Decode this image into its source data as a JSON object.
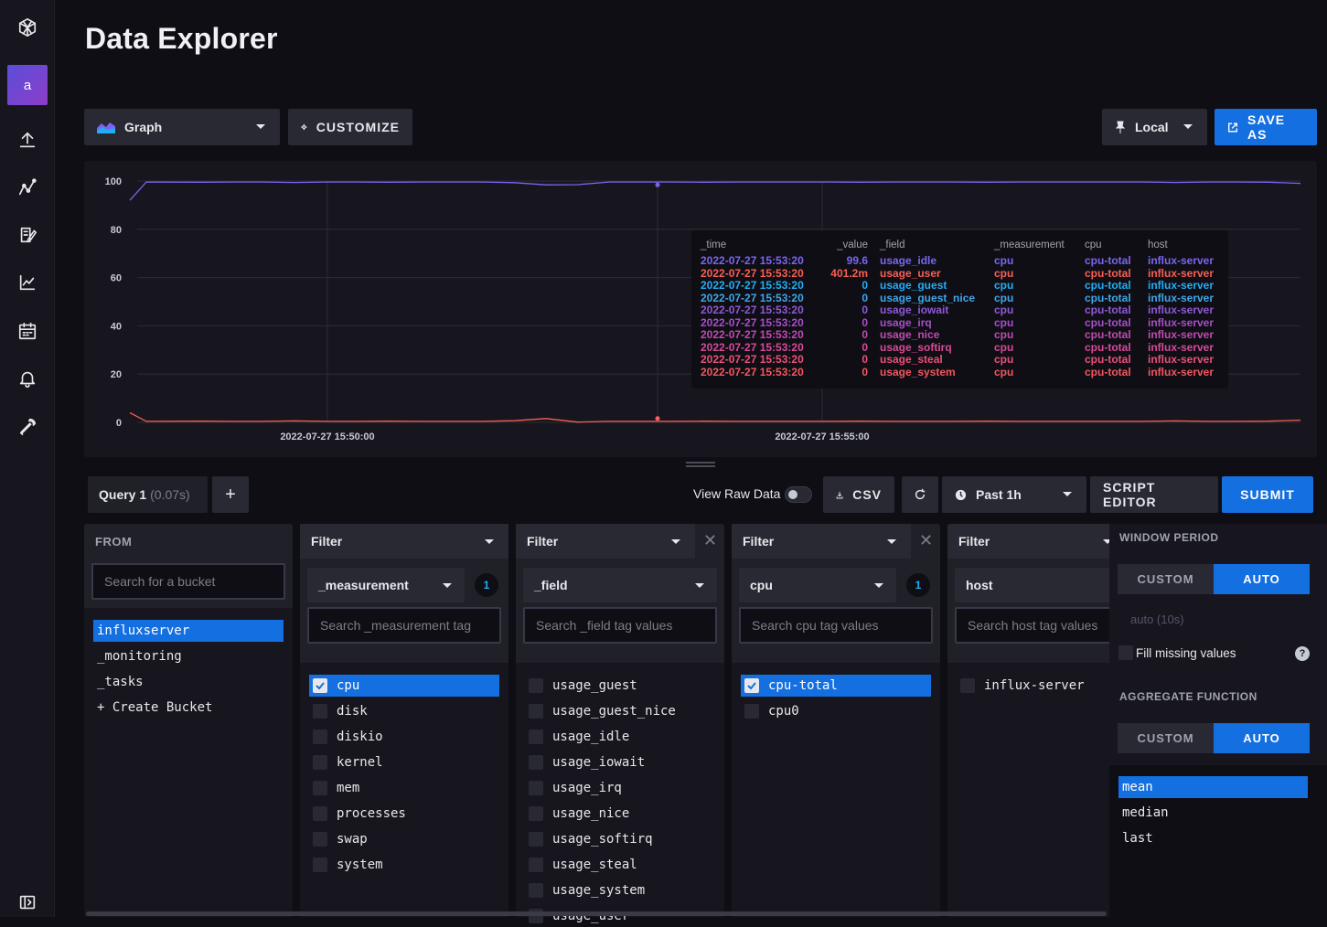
{
  "page": {
    "title": "Data Explorer"
  },
  "sidebar": {
    "avatar_letter": "a",
    "icons": [
      "influx-logo-icon",
      "upload-icon",
      "graph-icon",
      "notebook-icon",
      "chart-icon",
      "calendar-icon",
      "bell-icon",
      "wrench-icon",
      "collapse-icon"
    ]
  },
  "toolbar": {
    "graph_type": "Graph",
    "customize": "CUSTOMIZE",
    "timezone": "Local",
    "save_as": "SAVE AS"
  },
  "chart_data": {
    "type": "line",
    "ylim": [
      0,
      100
    ],
    "y_ticks": [
      "100",
      "80",
      "60",
      "40",
      "20",
      "0"
    ],
    "x_ticks": [
      "2022-07-27 15:50:00",
      "2022-07-27 15:55:00"
    ],
    "colors": {
      "accent": "#7a65f2",
      "secondary": "#f95f53"
    },
    "series": [
      {
        "name": "usage_idle",
        "color": "#7a65f2",
        "values": [
          92,
          99.6,
          99.5,
          99.6,
          99.6,
          99.4,
          99.6,
          99.6,
          99.5,
          99.6,
          99.6,
          99.6,
          99.3,
          98.4,
          98.5,
          99.6,
          99.6,
          99.6,
          99.5,
          99.6,
          99.6,
          99.6,
          99.6,
          99.5,
          99.6,
          99.6,
          99.6,
          99.5,
          99.6,
          99.6,
          99.6,
          99.6,
          99.6,
          99.4,
          99.6,
          99.6,
          99.5,
          99
        ]
      },
      {
        "name": "usage_user",
        "color": "#f95f53",
        "values": [
          4,
          0.4,
          0.5,
          0.4,
          0.4,
          0.6,
          0.4,
          0.4,
          0.5,
          0.4,
          0.4,
          0.4,
          0.7,
          1.6,
          0.1,
          0.4,
          0.4,
          0.4,
          0.5,
          0.4,
          0.4,
          0.4,
          0.4,
          0.5,
          0.4,
          0.4,
          0.4,
          0.5,
          0.4,
          0.4,
          0.4,
          0.4,
          0.4,
          0.6,
          0.4,
          0.4,
          0.5,
          0.9
        ]
      }
    ],
    "highlight_index": 13
  },
  "legend": {
    "headers": [
      "_time",
      "_value",
      "_field",
      "_measurement",
      "cpu",
      "host"
    ],
    "rows": [
      {
        "time": "2022-07-27 15:53:20",
        "value": "99.6",
        "field": "usage_idle",
        "measurement": "cpu",
        "cpu": "cpu-total",
        "host": "influx-server",
        "color": "#7a65f2"
      },
      {
        "time": "2022-07-27 15:53:20",
        "value": "401.2m",
        "field": "usage_user",
        "measurement": "cpu",
        "cpu": "cpu-total",
        "host": "influx-server",
        "color": "#f95f53"
      },
      {
        "time": "2022-07-27 15:53:20",
        "value": "0",
        "field": "usage_guest",
        "measurement": "cpu",
        "cpu": "cpu-total",
        "host": "influx-server",
        "color": "#22adf6"
      },
      {
        "time": "2022-07-27 15:53:20",
        "value": "0",
        "field": "usage_guest_nice",
        "measurement": "cpu",
        "cpu": "cpu-total",
        "host": "influx-server",
        "color": "#3fa6e8"
      },
      {
        "time": "2022-07-27 15:53:20",
        "value": "0",
        "field": "usage_iowait",
        "measurement": "cpu",
        "cpu": "cpu-total",
        "host": "influx-server",
        "color": "#8e59d6"
      },
      {
        "time": "2022-07-27 15:53:20",
        "value": "0",
        "field": "usage_irq",
        "measurement": "cpu",
        "cpu": "cpu-total",
        "host": "influx-server",
        "color": "#a64fc9"
      },
      {
        "time": "2022-07-27 15:53:20",
        "value": "0",
        "field": "usage_nice",
        "measurement": "cpu",
        "cpu": "cpu-total",
        "host": "influx-server",
        "color": "#c04bb0"
      },
      {
        "time": "2022-07-27 15:53:20",
        "value": "0",
        "field": "usage_softirq",
        "measurement": "cpu",
        "cpu": "cpu-total",
        "host": "influx-server",
        "color": "#d74b95"
      },
      {
        "time": "2022-07-27 15:53:20",
        "value": "0",
        "field": "usage_steal",
        "measurement": "cpu",
        "cpu": "cpu-total",
        "host": "influx-server",
        "color": "#e9507a"
      },
      {
        "time": "2022-07-27 15:53:20",
        "value": "0",
        "field": "usage_system",
        "measurement": "cpu",
        "cpu": "cpu-total",
        "host": "influx-server",
        "color": "#f4565f"
      }
    ]
  },
  "query_bar": {
    "query_name": "Query 1",
    "query_time": "(0.07s)",
    "add": "+",
    "view_raw": "View Raw Data",
    "csv": "CSV",
    "time_range": "Past 1h",
    "script_editor": "SCRIPT EDITOR",
    "submit": "SUBMIT"
  },
  "from": {
    "title": "FROM",
    "search_placeholder": "Search for a bucket",
    "buckets": [
      "influxserver",
      "_monitoring",
      "_tasks",
      "+ Create Bucket"
    ]
  },
  "filter1": {
    "title": "Filter",
    "key": "_measurement",
    "count": "1",
    "search_placeholder": "Search _measurement tag",
    "values": [
      "cpu",
      "disk",
      "diskio",
      "kernel",
      "mem",
      "processes",
      "swap",
      "system"
    ]
  },
  "filter2": {
    "title": "Filter",
    "key": "_field",
    "search_placeholder": "Search _field tag values",
    "values": [
      "usage_guest",
      "usage_guest_nice",
      "usage_idle",
      "usage_iowait",
      "usage_irq",
      "usage_nice",
      "usage_softirq",
      "usage_steal",
      "usage_system",
      "usage_user"
    ]
  },
  "filter3": {
    "title": "Filter",
    "key": "cpu",
    "count": "1",
    "search_placeholder": "Search cpu tag values",
    "values": [
      "cpu-total",
      "cpu0"
    ]
  },
  "filter4": {
    "title": "Filter",
    "key": "host",
    "search_placeholder": "Search host tag values",
    "values": [
      "influx-server"
    ]
  },
  "aggregate": {
    "window_title": "WINDOW PERIOD",
    "custom": "CUSTOM",
    "auto": "AUTO",
    "window_value": "auto (10s)",
    "fill_missing": "Fill missing values",
    "help": "?",
    "function_title": "AGGREGATE FUNCTION",
    "functions": [
      "mean",
      "median",
      "last"
    ]
  }
}
